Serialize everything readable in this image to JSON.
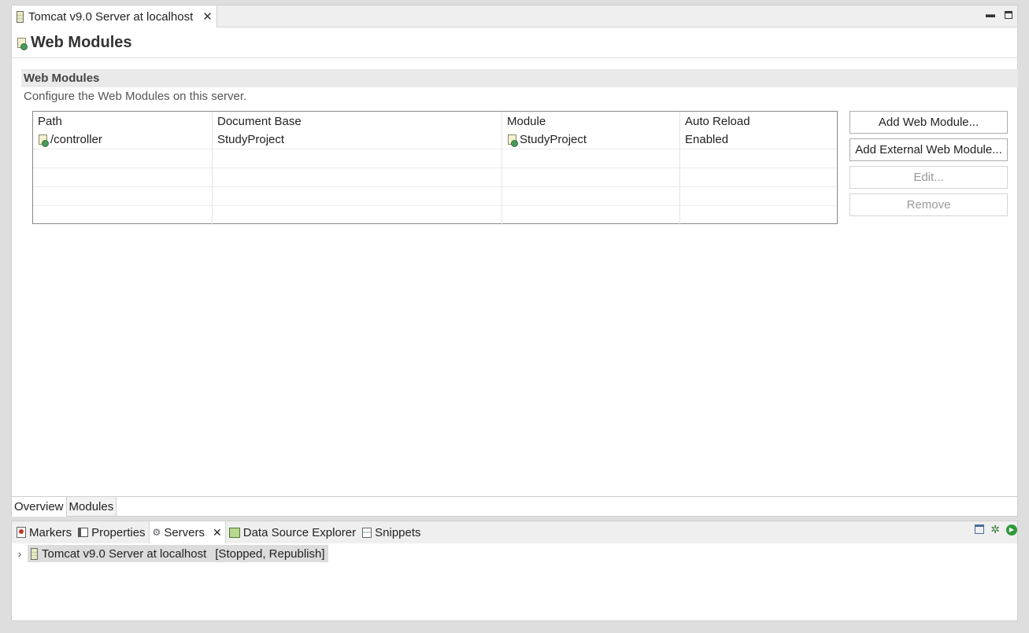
{
  "editor": {
    "tab_title": "Tomcat v9.0 Server at localhost",
    "form_title": "Web Modules",
    "section_title": "Web Modules",
    "section_description": "Configure the Web Modules on this server.",
    "table": {
      "columns": [
        "Path",
        "Document Base",
        "Module",
        "Auto Reload"
      ],
      "rows": [
        {
          "path": "/controller",
          "document_base": "StudyProject",
          "module": "StudyProject",
          "auto_reload": "Enabled"
        }
      ]
    },
    "buttons": {
      "add_web_module": "Add Web Module...",
      "add_external_web_module": "Add External Web Module...",
      "edit": "Edit...",
      "remove": "Remove"
    },
    "page_tabs": [
      "Overview",
      "Modules"
    ],
    "active_page_tab": "Modules"
  },
  "views": {
    "tabs": [
      {
        "label": "Markers",
        "icon": "markers-icon"
      },
      {
        "label": "Properties",
        "icon": "properties-icon"
      },
      {
        "label": "Servers",
        "icon": "servers-icon"
      },
      {
        "label": "Data Source Explorer",
        "icon": "data-source-icon"
      },
      {
        "label": "Snippets",
        "icon": "snippets-icon"
      }
    ],
    "active_tab": "Servers",
    "server_entry": "Tomcat v9.0 Server at localhost",
    "server_status": "[Stopped, Republish]"
  },
  "colors": {
    "tab_bar": "#efefef",
    "selection": "#dcdcdc",
    "run_green": "#2e9a3a"
  }
}
